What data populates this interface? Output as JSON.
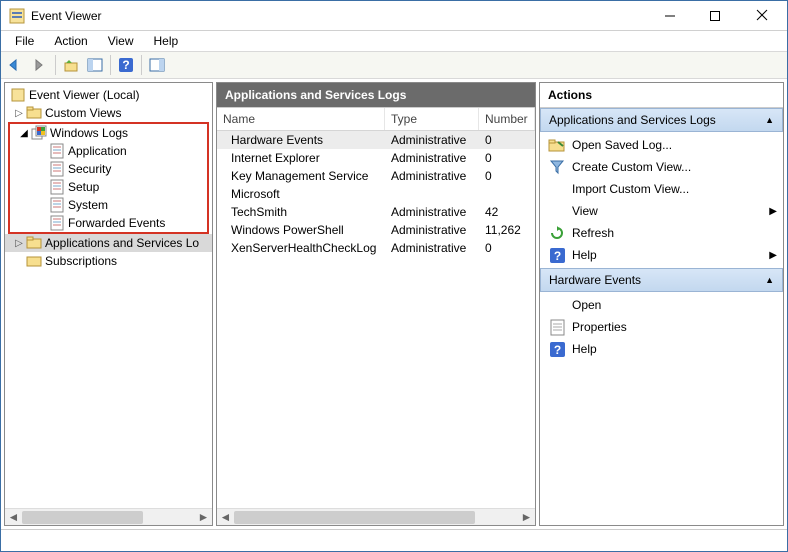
{
  "window": {
    "title": "Event Viewer"
  },
  "menu": {
    "file": "File",
    "action": "Action",
    "view": "View",
    "help": "Help"
  },
  "tree": {
    "root": "Event Viewer (Local)",
    "custom": "Custom Views",
    "winlogs": "Windows Logs",
    "winlogs_children": {
      "app": "Application",
      "sec": "Security",
      "setup": "Setup",
      "sys": "System",
      "fwd": "Forwarded Events"
    },
    "appsvc": "Applications and Services Lo",
    "subs": "Subscriptions"
  },
  "center": {
    "header": "Applications and Services Logs",
    "columns": {
      "name": "Name",
      "type": "Type",
      "number": "Number"
    },
    "rows": [
      {
        "name": "Hardware Events",
        "type": "Administrative",
        "number": "0",
        "sel": true
      },
      {
        "name": "Internet Explorer",
        "type": "Administrative",
        "number": "0"
      },
      {
        "name": "Key Management Service",
        "type": "Administrative",
        "number": "0"
      },
      {
        "name": "Microsoft",
        "type": "",
        "number": ""
      },
      {
        "name": "TechSmith",
        "type": "Administrative",
        "number": "42"
      },
      {
        "name": "Windows PowerShell",
        "type": "Administrative",
        "number": "11,262"
      },
      {
        "name": "XenServerHealthCheckLog",
        "type": "Administrative",
        "number": "0"
      }
    ]
  },
  "actions": {
    "title": "Actions",
    "section1": "Applications and Services Logs",
    "items1": [
      {
        "k": "open_saved",
        "label": "Open Saved Log...",
        "icon": "folder"
      },
      {
        "k": "create_view",
        "label": "Create Custom View...",
        "icon": "filter"
      },
      {
        "k": "import_view",
        "label": "Import Custom View...",
        "icon": ""
      },
      {
        "k": "view",
        "label": "View",
        "icon": "",
        "sub": true
      },
      {
        "k": "refresh",
        "label": "Refresh",
        "icon": "refresh"
      },
      {
        "k": "help1",
        "label": "Help",
        "icon": "help",
        "sub": true
      }
    ],
    "section2": "Hardware Events",
    "items2": [
      {
        "k": "open",
        "label": "Open",
        "icon": ""
      },
      {
        "k": "props",
        "label": "Properties",
        "icon": "props"
      },
      {
        "k": "help2",
        "label": "Help",
        "icon": "help"
      }
    ]
  }
}
